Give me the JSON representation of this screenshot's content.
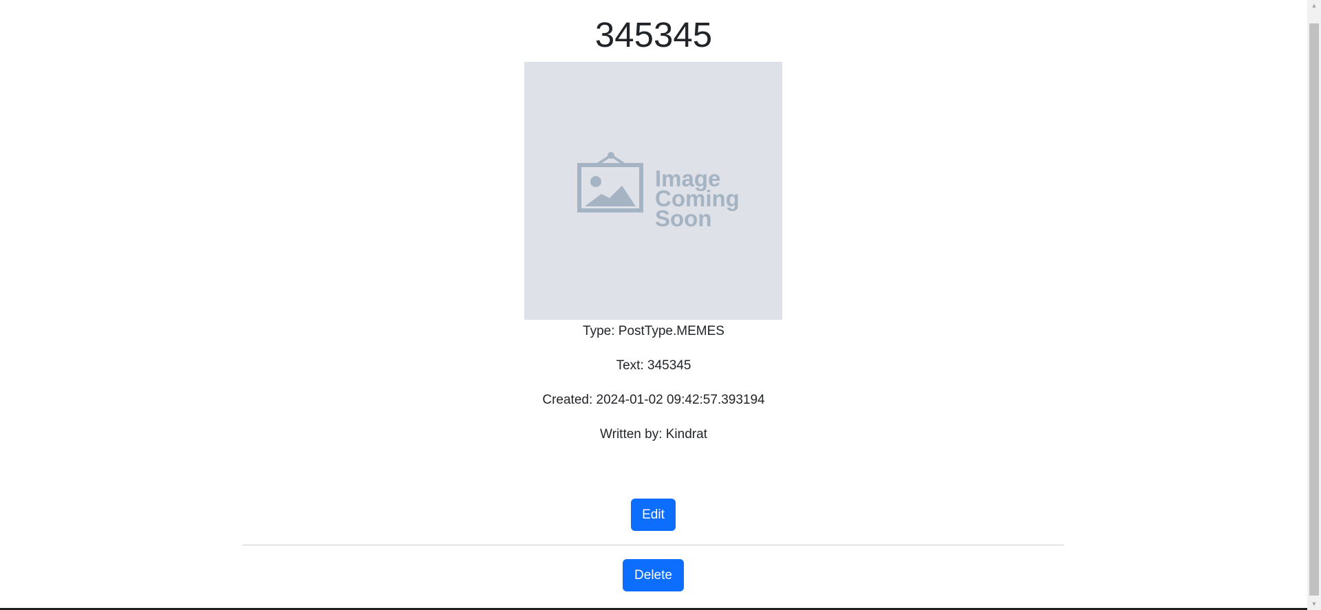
{
  "post": {
    "title": "345345",
    "image": {
      "placeholder_lines": [
        "Image",
        "Coming",
        "Soon"
      ],
      "icon": "framed-picture-icon",
      "background_color": "#dee2e8",
      "graphic_color": "#a5b3c2"
    },
    "type_line": "Type: PostType.MEMES",
    "text_line": "Text: 345345",
    "created_line": "Created: 2024-01-02 09:42:57.393194",
    "author_line": "Written by: Kindrat"
  },
  "actions": {
    "edit_label": "Edit",
    "delete_label": "Delete",
    "button_color": "#0d6efd"
  },
  "scrollbar": {
    "up_icon": "triangle-up-icon",
    "down_icon": "triangle-down-icon"
  }
}
